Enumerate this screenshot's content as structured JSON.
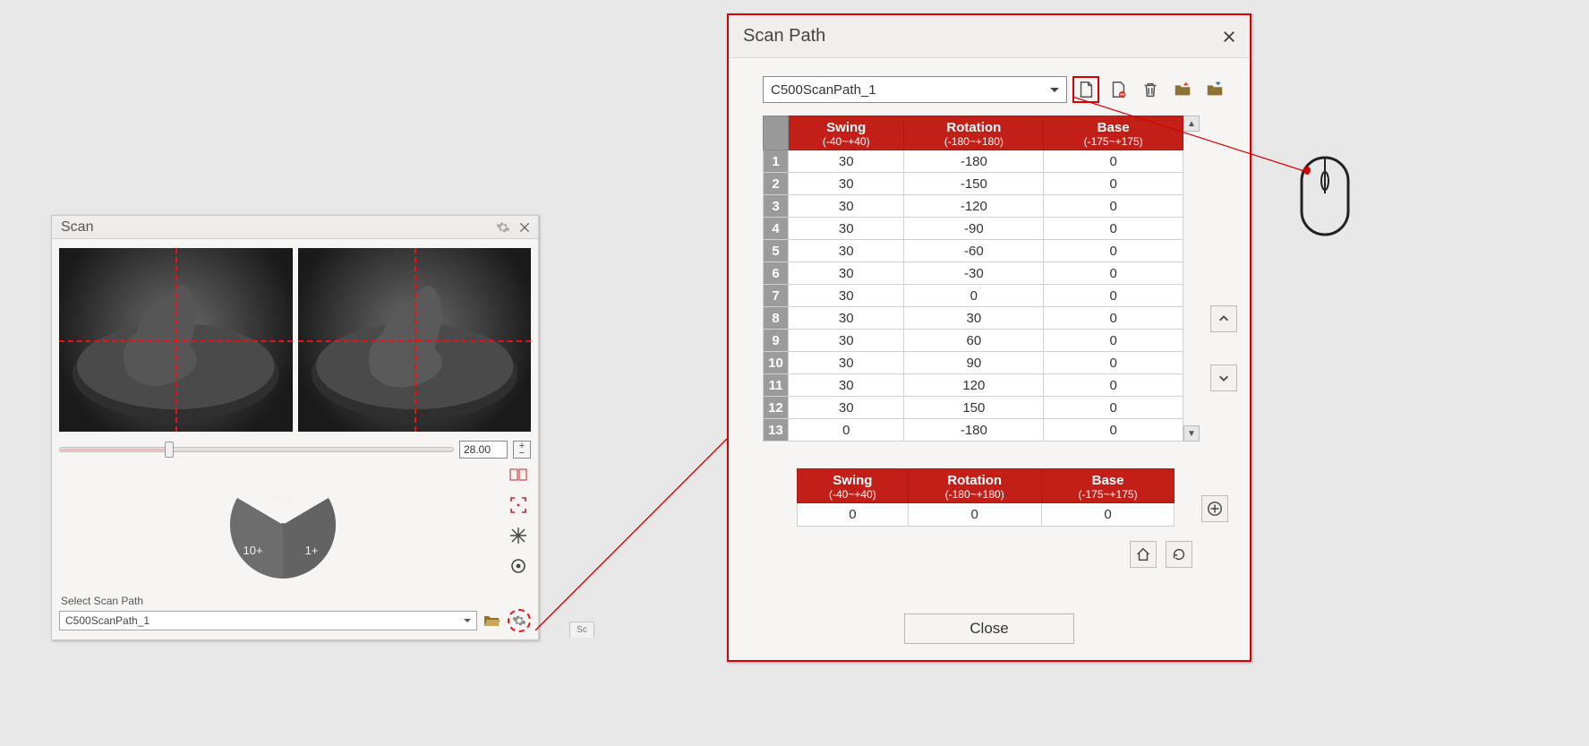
{
  "scan_window": {
    "title": "Scan",
    "slider_value": "28.00",
    "pie": {
      "auto": "Auto",
      "ten": "10+",
      "one": "1+"
    },
    "select_label": "Select Scan Path",
    "select_value": "C500ScanPath_1",
    "side_tab": "Sc"
  },
  "scan_path_window": {
    "title": "Scan Path",
    "select_value": "C500ScanPath_1",
    "headers": {
      "swing": "Swing",
      "swing_range": "(-40~+40)",
      "rotation": "Rotation",
      "rotation_range": "(-180~+180)",
      "base": "Base",
      "base_range": "(-175~+175)"
    },
    "rows": [
      {
        "n": "1",
        "swing": "30",
        "rot": "-180",
        "base": "0"
      },
      {
        "n": "2",
        "swing": "30",
        "rot": "-150",
        "base": "0"
      },
      {
        "n": "3",
        "swing": "30",
        "rot": "-120",
        "base": "0"
      },
      {
        "n": "4",
        "swing": "30",
        "rot": "-90",
        "base": "0"
      },
      {
        "n": "5",
        "swing": "30",
        "rot": "-60",
        "base": "0"
      },
      {
        "n": "6",
        "swing": "30",
        "rot": "-30",
        "base": "0"
      },
      {
        "n": "7",
        "swing": "30",
        "rot": "0",
        "base": "0"
      },
      {
        "n": "8",
        "swing": "30",
        "rot": "30",
        "base": "0"
      },
      {
        "n": "9",
        "swing": "30",
        "rot": "60",
        "base": "0"
      },
      {
        "n": "10",
        "swing": "30",
        "rot": "90",
        "base": "0"
      },
      {
        "n": "11",
        "swing": "30",
        "rot": "120",
        "base": "0"
      },
      {
        "n": "12",
        "swing": "30",
        "rot": "150",
        "base": "0"
      },
      {
        "n": "13",
        "swing": "0",
        "rot": "-180",
        "base": "0"
      }
    ],
    "add_row": {
      "swing": "0",
      "rot": "0",
      "base": "0"
    },
    "close_label": "Close"
  }
}
